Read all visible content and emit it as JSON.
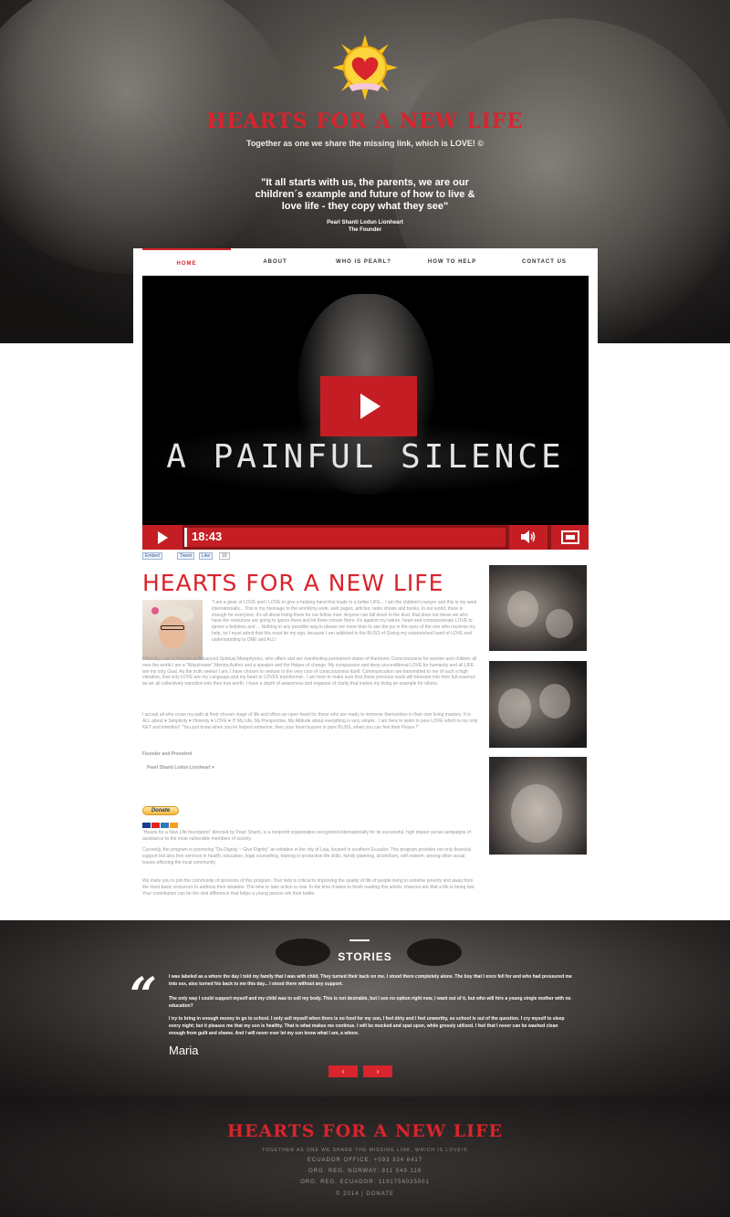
{
  "hero": {
    "logo_title": "HEARTS FOR A NEW LIFE",
    "tagline": "Together as one we share the missing link, which is LOVE! ©",
    "quote": "\"It all starts with us, the parents, we are our children´s example and future of how to live & love life - they copy what they see\"",
    "author_name": "Pearl Shanti Lodun Lionheart",
    "author_role": "The Founder"
  },
  "nav": {
    "items": [
      {
        "label": "HOME"
      },
      {
        "label": "ABOUT"
      },
      {
        "label": "WHO IS PEARL?"
      },
      {
        "label": "HOW TO HELP"
      },
      {
        "label": "CONTACT US"
      }
    ]
  },
  "video": {
    "title": "A PAINFUL SILENCE",
    "duration": "18:43",
    "volume_icon": "speaker-icon",
    "share": [
      {
        "label": "Embed"
      },
      {
        "label": "Tweet"
      },
      {
        "label": "Like"
      },
      {
        "label": "10"
      }
    ]
  },
  "content": {
    "title": "HEARTS FOR A NEW LIFE",
    "bio_1": "\"I am a giver of LOVE and I LOVE to give a helping hand that leads to a better LIFE... I am the children's lawyer and this is my work internationally... This is my message to the world(my work, web pages, articles, radio shows and books. In our world, there is enough for everyone, it's all about being there for our fellow man. Anyone can fall down in the dust, that does not mean we who have the resources are going to ignore them and let them remain there, it's against my nature, heart and compassionate LOVE to ignore a helpless and ... Nothing in any possible way,to please me more than to see the joy in the eyes of the one who receives my help, so I must admit that this must be my ego, because I am addicted to the BLISS of Giving my outstretched hand of LOVE and understanding to ONE and ALL!",
    "bio_2": "Officially, I am a Teacher of Advanced Spiritual Metaphysics, who offers and are manifesting permanent states of Harmonic Consciousness for women and children all over the world.I am a \"Wayshower\",Mentor,Author and a speaker and the Helper of change. My compassion and deep unconditional LOVE for humanity and all LIFE are my only Goal. As the truth seeker I am, I have chosen to venture to the very core of consciousness itself. Communication are transmitted to me of such a high vibration, that only LOVE are my Language,and my heart is LOVES transformer.. I am here to make sure that these precious souls will blossom into their full essence as we all collectively transition into their true worth. I have a depth of awareness and expanse of clarity that makes my living an example for others.",
    "bio_3": "I accept all who cross my path at their chosen stage of life and offers an open heart for those who are ready to immerse themselves in their own living mastery. It is ALL about ♥ Simplicity ♥ Honesty ♥ LOVE ♥ !!! My Life, My Perspective, My Attitude about everything is very simple.. I am here to swim in pure LOVE which is my only KEY and intention! \"You just know when you've helped someone, then your heart buzzes in pure BLISS, when you can feel their Peace !\"",
    "founder_role": "Founder and President",
    "founder_name": "Pearl Shanti Lodun Lionheart ♥",
    "donate_label": "Donate",
    "para_1": "\"Hearts for a New Life foundation\" directed by Pearl Shanti, is a nonprofit organization recognized internationally for its successful, high impact social campaigns of assistance to the most vulnerable members of society.",
    "para_2": "Currently, the program is promoting \"Da Dignity ~ Give Dignity\" an initiative in the city of Loja, located in southern Ecuador. This program provides not only financial support but also free services in health, education, legal counseling, training in productive life skills, family planning, alcoholism, self esteem, among other social issues affecting the local community.",
    "para_3": "We invite you to join the community of sponsors of this program. Your help is critical to improving the quality of life of people living in extreme poverty and away from the most basic resources to address their situation. The time to take action is now. In the time it takes to finish reading this article, chances are that a life is being lost. Your contribution can be the vital difference that helps a young person win their battle."
  },
  "stories": {
    "heading": "STORIES",
    "quote_mark": "“",
    "text_1": "I was labeled as a whore the day I told my family that I was with child. They turned their back on me. I stood there completely alone. The boy that I once fell for and who had pressured me into sex, also turned his back to me this day... I stood there without any support.",
    "text_2": "The only way I could support myself and my child was to sell my body. This is not desirable, but I see no option right now, I want out of it, but who will hire a young single mother with no education?",
    "text_3": "I try to bring in enough money to go to school. I only sell myself when there is no food for my son, I feel dirty and I feel unworthy, so school is out of the question. I cry myself to sleep every night; but it pleases me that my son is healthy. That is what makes me continue. I will be mocked and spat upon, while grossly utilized. I feel that I never can be washed clean enough from guilt and shame. And I will never ever let my son know what I am, a whore.",
    "author": "Maria",
    "prev": "‹",
    "next": "›"
  },
  "footer": {
    "logo_title": "HEARTS FOR A NEW LIFE",
    "tagline": "TOGETHER AS ONE WE SHARE THE MISSING LINK, WHICH IS LOVE!©",
    "office": "ECUADOR OFFICE: +093 334 6417",
    "reg_norway": "ORG. REG. NORWAY: 911 549 119",
    "reg_ecuador": "ORG. REG. ECUADOR: 1191756035001",
    "copyright": "© 2014 | DONATE"
  },
  "colors": {
    "accent": "#d8242c",
    "dark_red": "#8a1418"
  }
}
